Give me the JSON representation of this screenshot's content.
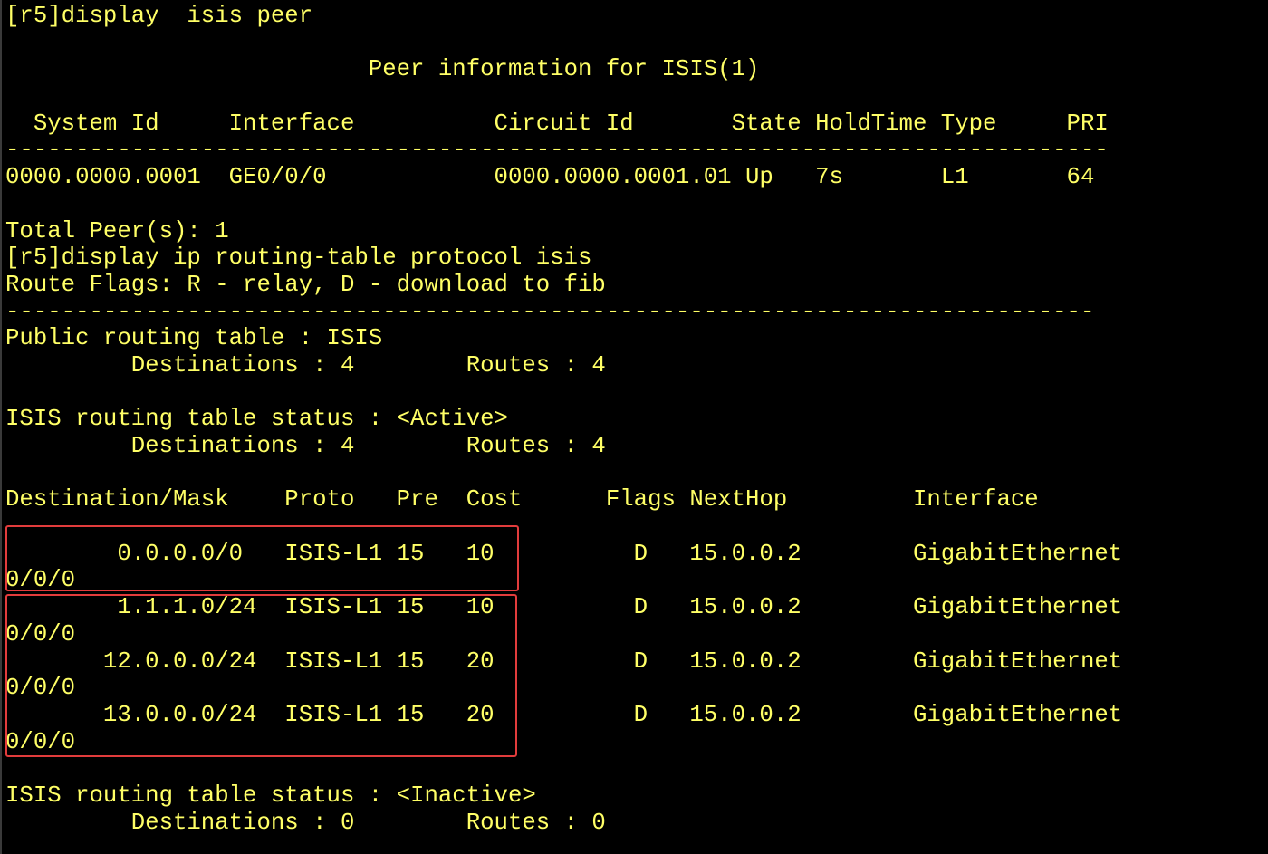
{
  "terminal": {
    "text_color": "#ffff66",
    "background": "#000000",
    "highlight_color": "#e23c3c",
    "lines": [
      "[r5]display  isis peer",
      "",
      "                          Peer information for ISIS(1)",
      "",
      "  System Id     Interface          Circuit Id       State HoldTime Type     PRI",
      "-------------------------------------------------------------------------------",
      "0000.0000.0001  GE0/0/0            0000.0000.0001.01 Up   7s       L1       64",
      "",
      "Total Peer(s): 1",
      "[r5]display ip routing-table protocol isis",
      "Route Flags: R - relay, D - download to fib",
      "------------------------------------------------------------------------------",
      "Public routing table : ISIS",
      "         Destinations : 4        Routes : 4",
      "",
      "ISIS routing table status : <Active>",
      "         Destinations : 4        Routes : 4",
      "",
      "Destination/Mask    Proto   Pre  Cost      Flags NextHop         Interface",
      "",
      "        0.0.0.0/0   ISIS-L1 15   10          D   15.0.0.2        GigabitEthernet",
      "0/0/0",
      "        1.1.1.0/24  ISIS-L1 15   10          D   15.0.0.2        GigabitEthernet",
      "0/0/0",
      "       12.0.0.0/24  ISIS-L1 15   20          D   15.0.0.2        GigabitEthernet",
      "0/0/0",
      "       13.0.0.0/24  ISIS-L1 15   20          D   15.0.0.2        GigabitEthernet",
      "0/0/0",
      "",
      "ISIS routing table status : <Inactive>",
      "         Destinations : 0        Routes : 0"
    ]
  }
}
